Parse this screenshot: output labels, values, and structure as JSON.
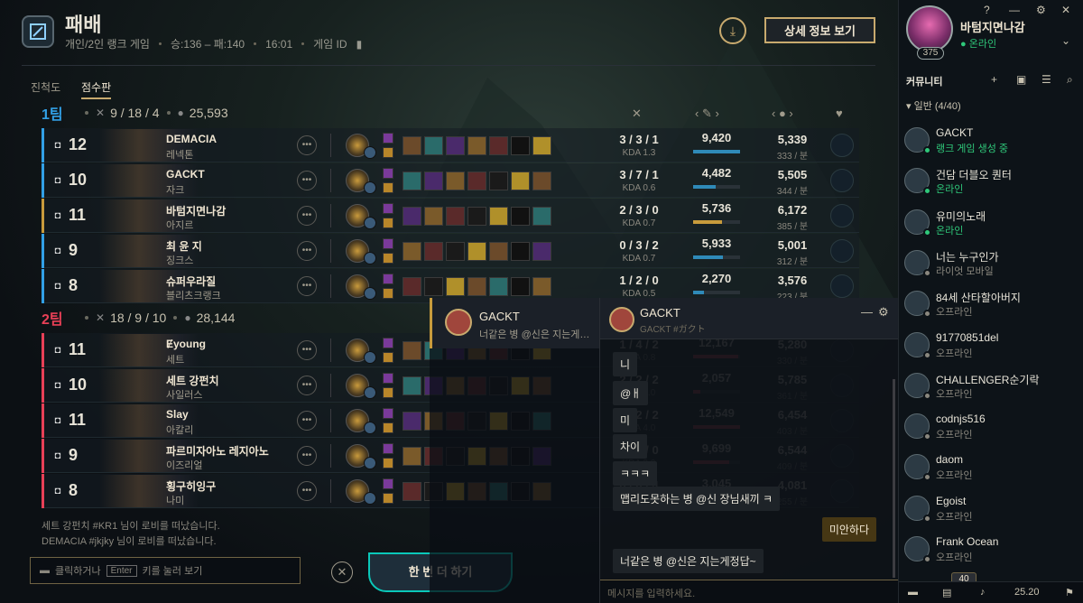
{
  "header": {
    "title": "패배",
    "queue": "개인/2인 랭크 게임",
    "record": "승:136 – 패:140",
    "time": "16:01",
    "game_id_label": "게임 ID",
    "detail_button": "상세 정보 보기"
  },
  "tabs": [
    {
      "label": "진척도"
    },
    {
      "label": "점수판"
    }
  ],
  "team1": {
    "name": "1팀",
    "kda": "9 / 18 / 4",
    "gold": "25,593",
    "color": "#32a0e6"
  },
  "team2": {
    "name": "2팀",
    "kda": "18 / 9 / 10",
    "gold": "28,144",
    "color": "#e84057"
  },
  "columns": {
    "damage": "‹ ✎ ›",
    "gold": "‹ ● ›"
  },
  "players1": [
    {
      "level": "12",
      "name": "DEMACIA",
      "champ": "레넥톤",
      "kda": "3 / 3 / 1",
      "ratio": "KDA 1.3",
      "dmg": "9,420",
      "dmg_frac": 1.0,
      "gold": "5,339",
      "gpm": "333 / 분",
      "bar": "#2f8ab8"
    },
    {
      "level": "10",
      "name": "GACKT",
      "champ": "자크",
      "kda": "3 / 7 / 1",
      "ratio": "KDA 0.6",
      "dmg": "4,482",
      "dmg_frac": 0.48,
      "gold": "5,505",
      "gpm": "344 / 분",
      "bar": "#2f8ab8"
    },
    {
      "level": "11",
      "name": "바텀지면나감",
      "champ": "아지르",
      "kda": "2 / 3 / 0",
      "ratio": "KDA 0.7",
      "dmg": "5,736",
      "dmg_frac": 0.61,
      "gold": "6,172",
      "gpm": "385 / 분",
      "bar": "#c89b3c"
    },
    {
      "level": "9",
      "name": "최 윤 지",
      "champ": "징크스",
      "kda": "0 / 3 / 2",
      "ratio": "KDA 0.7",
      "dmg": "5,933",
      "dmg_frac": 0.63,
      "gold": "5,001",
      "gpm": "312 / 분",
      "bar": "#2f8ab8"
    },
    {
      "level": "8",
      "name": "슈퍼우라질",
      "champ": "블리츠크랭크",
      "kda": "1 / 2 / 0",
      "ratio": "KDA 0.5",
      "dmg": "2,270",
      "dmg_frac": 0.24,
      "gold": "3,576",
      "gpm": "223 / 분",
      "bar": "#2f8ab8"
    }
  ],
  "players2": [
    {
      "level": "11",
      "name": "Ɇyoung",
      "champ": "세트",
      "kda": "1 / 4 / 2",
      "ratio": "KDA 0.8",
      "dmg": "12,167",
      "dmg_frac": 0.97,
      "gold": "5,280",
      "gpm": "330 / 분",
      "bar": "#e84057"
    },
    {
      "level": "10",
      "name": "세트 강펀치",
      "champ": "사일러스",
      "kda": "2 / 2 / 2",
      "ratio": "KDA 2.0",
      "dmg": "2,057",
      "dmg_frac": 0.16,
      "gold": "5,785",
      "gpm": "361 / 분",
      "bar": "#e84057"
    },
    {
      "level": "11",
      "name": "Slay",
      "champ": "아칼리",
      "kda": "6 / 2 / 2",
      "ratio": "KDA 4.0",
      "dmg": "12,549",
      "dmg_frac": 1.0,
      "gold": "6,454",
      "gpm": "403 / 분",
      "bar": "#e84057"
    },
    {
      "level": "9",
      "name": "파르미자아노 레지아노",
      "champ": "이즈리얼",
      "kda": "3 / 1 / 0",
      "ratio": "KDA 3.0",
      "dmg": "9,699",
      "dmg_frac": 0.77,
      "gold": "6,544",
      "gpm": "409 / 분",
      "bar": "#e84057"
    },
    {
      "level": "8",
      "name": "횡구히잉구",
      "champ": "나미",
      "kda": "0 / 0 / 4",
      "ratio": "KDA 4.0",
      "dmg": "3,045",
      "dmg_frac": 0.24,
      "gold": "4,081",
      "gpm": "255 / 분",
      "bar": "#e84057"
    }
  ],
  "system_messages": [
    "세트 강펀치 #KR1 님이 로비를 떠났습니다.",
    "DEMACIA #jkjky 님이 로비를 떠났습니다."
  ],
  "chat_input": {
    "prefix": "클릭하거나",
    "key": "Enter",
    "suffix": "키를 눌러 보기"
  },
  "play_again": "한 번 더 하기",
  "chat_tab": {
    "name": "GACKT",
    "preview": "너같은 병 @신은 지는게정답~"
  },
  "chat": {
    "name": "GACKT",
    "tag": "GACKT #ガクト",
    "messages": [
      {
        "text": "니",
        "me": false
      },
      {
        "text": "@ㅐ",
        "me": false
      },
      {
        "text": "미",
        "me": false
      },
      {
        "text": "차이",
        "me": false
      },
      {
        "text": "ㅋㅋㅋ",
        "me": false
      },
      {
        "text": "맵리도못하는 병 @신 장님새끼 ㅋ",
        "me": false
      },
      {
        "text": "미안하다",
        "me": true
      },
      {
        "text": "너같은 병 @신은 지는게정답~",
        "me": false
      }
    ],
    "placeholder": "메시지를 입력하세요."
  },
  "profile": {
    "name": "바텀지면나감",
    "status": "온라인",
    "level": "375"
  },
  "community": {
    "header": "커뮤니티",
    "group": "일반 (4/40)"
  },
  "friends": [
    {
      "name": "GACKT",
      "status": "랭크 게임 생성 중",
      "color": "#2fc87a"
    },
    {
      "name": "건담 더블오 퀀터",
      "status": "온라인",
      "color": "#2fc87a"
    },
    {
      "name": "유미의노래",
      "status": "온라인",
      "color": "#2fc87a"
    },
    {
      "name": "너는 누구인가",
      "status": "라이엇 모바일",
      "color": "#8a877e"
    },
    {
      "name": "84세 산타할아버지",
      "status": "오프라인",
      "color": "#8a877e"
    },
    {
      "name": "91770851del",
      "status": "오프라인",
      "color": "#8a877e"
    },
    {
      "name": "CHALLENGER순기락",
      "status": "오프라인",
      "color": "#8a877e"
    },
    {
      "name": "codnjs516",
      "status": "오프라인",
      "color": "#8a877e"
    },
    {
      "name": "daom",
      "status": "오프라인",
      "color": "#8a877e"
    },
    {
      "name": "Egoist",
      "status": "오프라인",
      "color": "#8a877e"
    },
    {
      "name": "Frank Ocean",
      "status": "오프라인",
      "color": "#8a877e"
    }
  ],
  "social_bottom": {
    "count": "40",
    "version": "25.20"
  }
}
